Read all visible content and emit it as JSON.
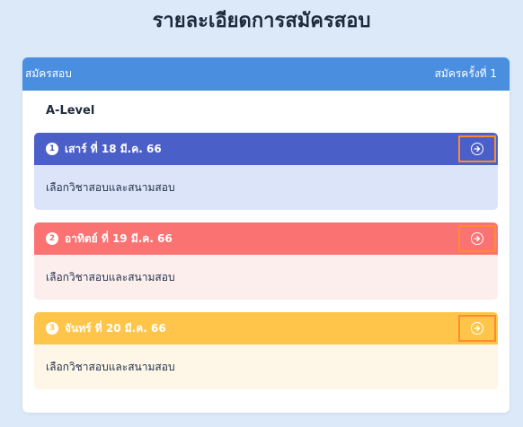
{
  "page": {
    "title": "รายละเอียดการสมัครสอบ"
  },
  "card": {
    "header_left": "สมัครสอบ",
    "header_right": "สมัครครั้งที่ 1",
    "section_title": "A-Level"
  },
  "days": [
    {
      "number": "1",
      "date_label": "เสาร์ ที่ 18 มี.ค. 66",
      "body_text": "เลือกวิชาสอบและสนามสอบ",
      "color": "#4b5fc9",
      "body_color": "#dbe4f9",
      "arrow_icon": "arrow-right-circle-icon"
    },
    {
      "number": "2",
      "date_label": "อาทิตย์ ที่ 19 มี.ค. 66",
      "body_text": "เลือกวิชาสอบและสนามสอบ",
      "color": "#fb7272",
      "body_color": "#fdeeee",
      "arrow_icon": "arrow-right-circle-icon"
    },
    {
      "number": "3",
      "date_label": "จันทร์ ที่ 20 มี.ค. 66",
      "body_text": "เลือกวิชาสอบและสนามสอบ",
      "color": "#ffc54a",
      "body_color": "#fef6e7",
      "arrow_icon": "arrow-right-circle-icon"
    }
  ],
  "colors": {
    "background": "#dbe9f9",
    "header": "#4a8ee0",
    "highlight_border": "#ff8b2e"
  }
}
